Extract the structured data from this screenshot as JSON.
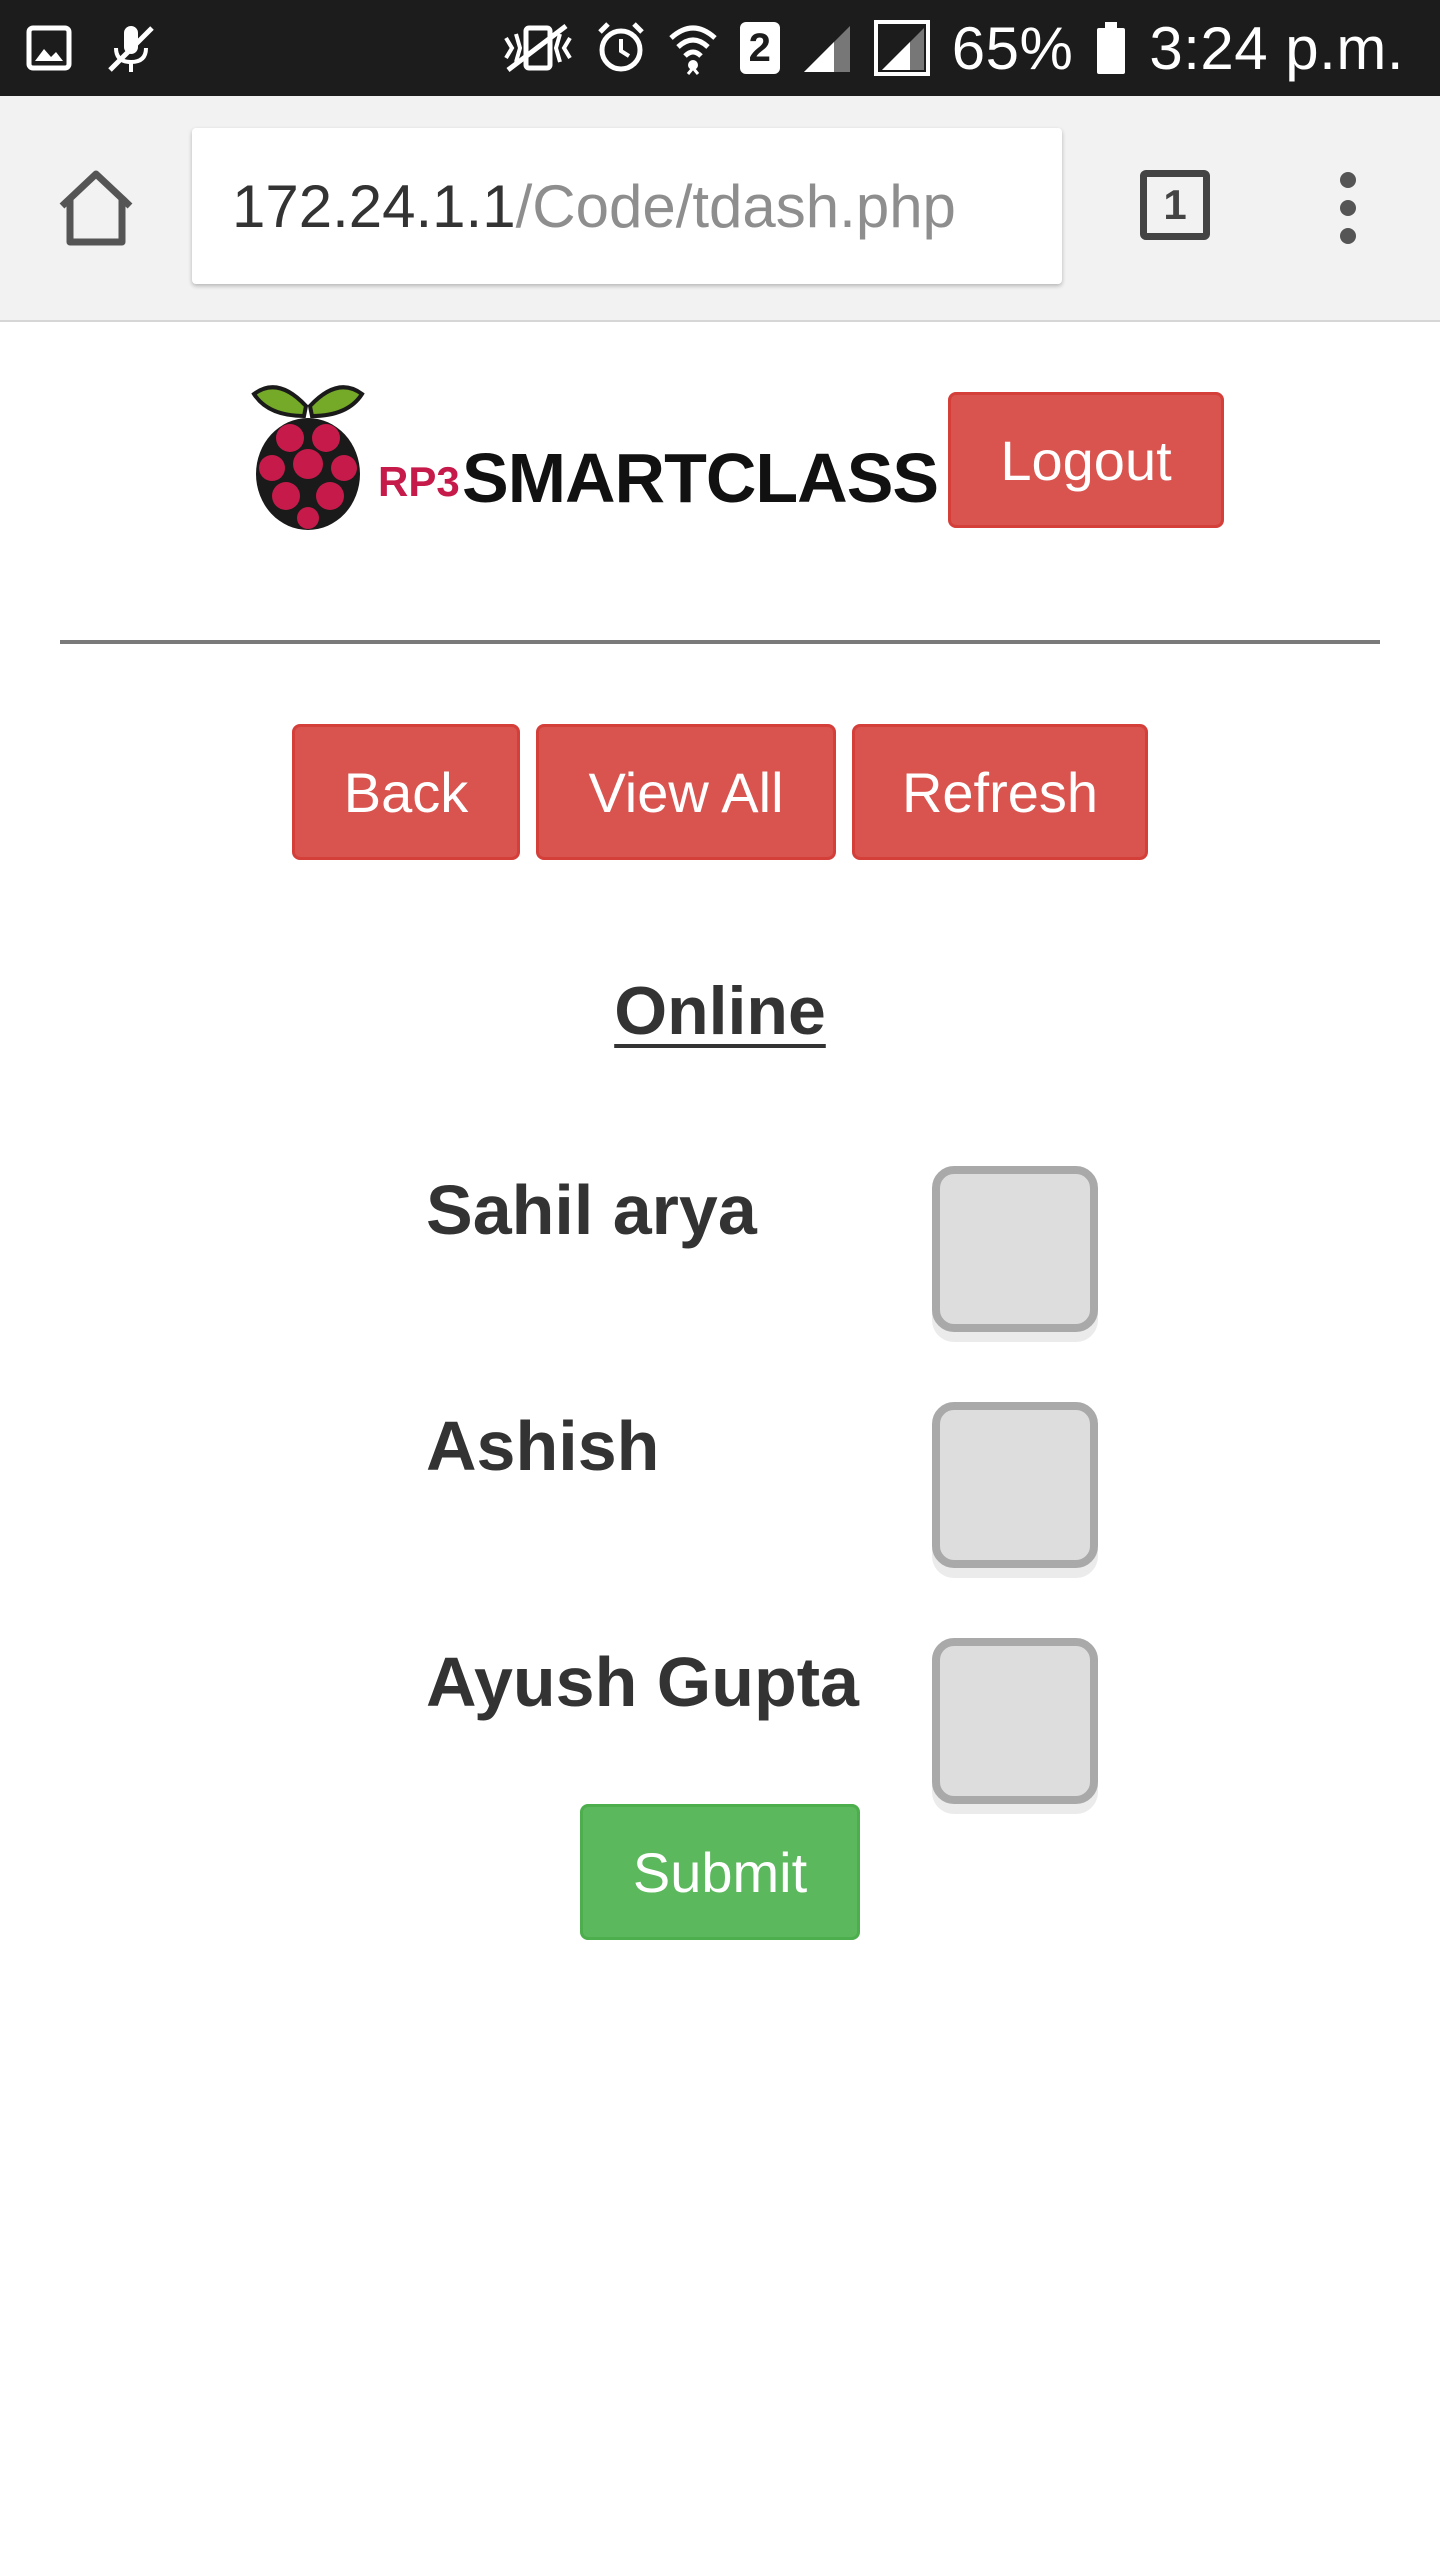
{
  "status_bar": {
    "battery": "65%",
    "time": "3:24 p.m.",
    "sim_badge": "2",
    "icons": [
      "gallery-icon",
      "muted-mic-icon",
      "vibrate-icon",
      "alarm-icon",
      "wifi-icon",
      "signal-icon",
      "signal-r-icon",
      "battery-icon"
    ]
  },
  "browser": {
    "url_host": "172.24.1.1",
    "url_path": "/Code/tdash.php",
    "tab_count": "1"
  },
  "header": {
    "logo_prefix": "RP3",
    "logo_name": "SMARTCLASS",
    "logout_label": "Logout"
  },
  "nav": {
    "back_label": "Back",
    "view_all_label": "View All",
    "refresh_label": "Refresh"
  },
  "section": {
    "title": "Online"
  },
  "students": [
    {
      "name": "Sahil arya",
      "checked": false
    },
    {
      "name": "Ashish",
      "checked": false
    },
    {
      "name": "Ayush Gupta",
      "checked": false
    }
  ],
  "form": {
    "submit_label": "Submit"
  },
  "colors": {
    "danger": "#d9534f",
    "success": "#5cb85c",
    "brand_red": "#c51a4a"
  }
}
